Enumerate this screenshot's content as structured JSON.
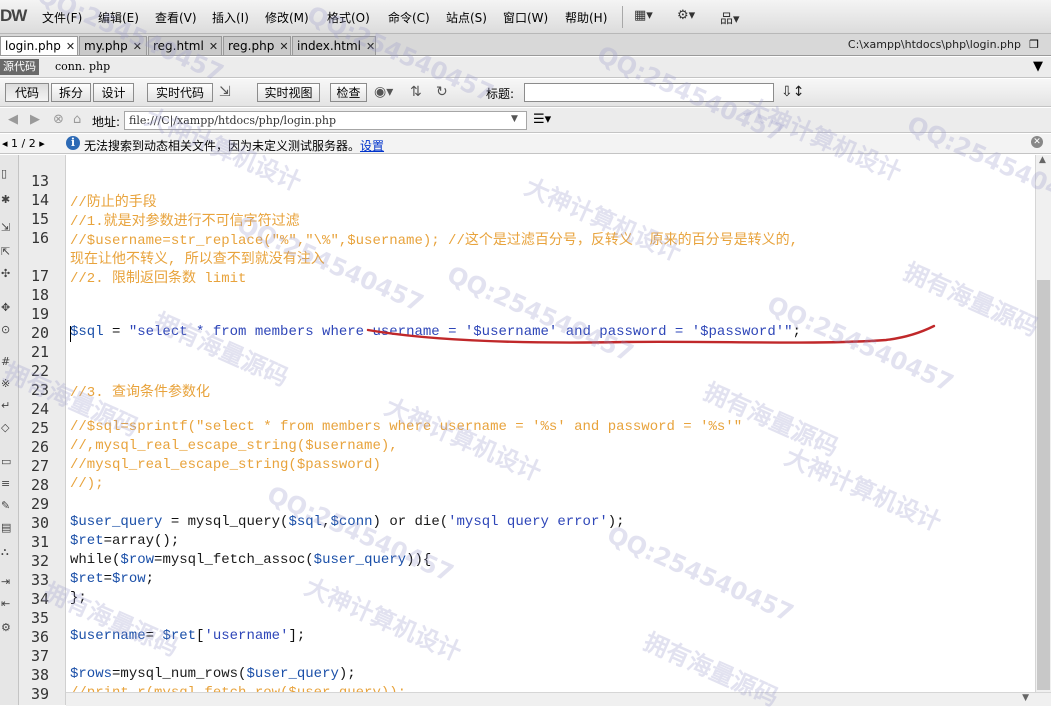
{
  "app": {
    "logo": "DW"
  },
  "menubar": {
    "items": [
      "文件(F)",
      "编辑(E)",
      "查看(V)",
      "插入(I)",
      "修改(M)",
      "格式(O)",
      "命令(C)",
      "站点(S)",
      "窗口(W)",
      "帮助(H)"
    ]
  },
  "tabs": [
    {
      "label": "login.php",
      "active": true
    },
    {
      "label": "my.php",
      "active": false
    },
    {
      "label": "reg.html",
      "active": false
    },
    {
      "label": "reg.php",
      "active": false
    },
    {
      "label": "index.html",
      "active": false
    }
  ],
  "file_path": "C:\\xampp\\htdocs\\php\\login.php",
  "related_files": {
    "source_label": "源代码",
    "file": "conn. php"
  },
  "doc_toolbar": {
    "code": "代码",
    "split": "拆分",
    "design": "设计",
    "live_code": "实时代码",
    "live_view": "实时视图",
    "inspect": "检查",
    "title_label": "标题:",
    "title_value": ""
  },
  "address": {
    "label": "地址:",
    "value": "file:///C|/xampp/htdocs/php/login.php"
  },
  "infobar": {
    "pages": "1 / 2",
    "message": "无法搜索到动态相关文件，因为未定义测试服务器。",
    "link": "设置"
  },
  "code_lines": [
    {
      "n": "13",
      "parts": []
    },
    {
      "n": "14",
      "parts": [
        {
          "c": "cm",
          "t": "//防止的手段"
        }
      ]
    },
    {
      "n": "15",
      "parts": [
        {
          "c": "cm",
          "t": "//1.就是对参数进行不可信字符过滤"
        }
      ]
    },
    {
      "n": "16",
      "parts": [
        {
          "c": "cm",
          "t": "//$username=str_replace(\"%\",\"\\%\",$username); //这个是过滤百分号，反转义  原来的百分号是转义的,"
        }
      ]
    },
    {
      "n": "",
      "parts": [
        {
          "c": "cm",
          "t": "现在让他不转义, 所以查不到就没有注入"
        }
      ]
    },
    {
      "n": "17",
      "parts": [
        {
          "c": "cm",
          "t": "//2. 限制返回条数 limit"
        }
      ]
    },
    {
      "n": "18",
      "parts": []
    },
    {
      "n": "19",
      "parts": []
    },
    {
      "n": "20",
      "parts": [
        {
          "c": "vr",
          "t": "$sql"
        },
        {
          "c": "pl",
          "t": " = "
        },
        {
          "c": "st",
          "t": "\"select * from members where username = '$username' and password = '$password'\""
        },
        {
          "c": "pl",
          "t": ";"
        }
      ]
    },
    {
      "n": "21",
      "parts": []
    },
    {
      "n": "22",
      "parts": []
    },
    {
      "n": "23",
      "parts": [
        {
          "c": "cm",
          "t": "//3. 查询条件参数化"
        }
      ]
    },
    {
      "n": "24",
      "parts": []
    },
    {
      "n": "25",
      "parts": [
        {
          "c": "cm",
          "t": "//$sql=sprintf(\"select * from members where username = '%s' and password = '%s'\""
        }
      ]
    },
    {
      "n": "26",
      "parts": [
        {
          "c": "cm",
          "t": "//,mysql_real_escape_string($username),"
        }
      ]
    },
    {
      "n": "27",
      "parts": [
        {
          "c": "cm",
          "t": "//mysql_real_escape_string($password)"
        }
      ]
    },
    {
      "n": "28",
      "parts": [
        {
          "c": "cm",
          "t": "//);"
        }
      ]
    },
    {
      "n": "29",
      "parts": []
    },
    {
      "n": "30",
      "parts": [
        {
          "c": "vr",
          "t": "$user_query"
        },
        {
          "c": "pl",
          "t": " = "
        },
        {
          "c": "kw",
          "t": "mysql_query("
        },
        {
          "c": "vr",
          "t": "$sql"
        },
        {
          "c": "pl",
          "t": ","
        },
        {
          "c": "vr",
          "t": "$conn"
        },
        {
          "c": "pl",
          "t": ") "
        },
        {
          "c": "kw",
          "t": "or die("
        },
        {
          "c": "st",
          "t": "'mysql query error'"
        },
        {
          "c": "pl",
          "t": ");"
        }
      ]
    },
    {
      "n": "31",
      "parts": [
        {
          "c": "vr",
          "t": "$ret"
        },
        {
          "c": "pl",
          "t": "="
        },
        {
          "c": "kw",
          "t": "array"
        },
        {
          "c": "pl",
          "t": "();"
        }
      ]
    },
    {
      "n": "32",
      "parts": [
        {
          "c": "kw",
          "t": "while"
        },
        {
          "c": "pl",
          "t": "("
        },
        {
          "c": "vr",
          "t": "$row"
        },
        {
          "c": "pl",
          "t": "="
        },
        {
          "c": "kw",
          "t": "mysql_fetch_assoc("
        },
        {
          "c": "vr",
          "t": "$user_query"
        },
        {
          "c": "pl",
          "t": ")){"
        }
      ]
    },
    {
      "n": "33",
      "parts": [
        {
          "c": "vr",
          "t": "$ret"
        },
        {
          "c": "pl",
          "t": "="
        },
        {
          "c": "vr",
          "t": "$row"
        },
        {
          "c": "pl",
          "t": ";"
        }
      ]
    },
    {
      "n": "34",
      "parts": [
        {
          "c": "pl",
          "t": "};"
        }
      ]
    },
    {
      "n": "35",
      "parts": []
    },
    {
      "n": "36",
      "parts": [
        {
          "c": "vr",
          "t": "$username"
        },
        {
          "c": "pl",
          "t": "= "
        },
        {
          "c": "vr",
          "t": "$ret"
        },
        {
          "c": "pl",
          "t": "["
        },
        {
          "c": "st",
          "t": "'username'"
        },
        {
          "c": "pl",
          "t": "];"
        }
      ]
    },
    {
      "n": "37",
      "parts": []
    },
    {
      "n": "38",
      "parts": [
        {
          "c": "vr",
          "t": "$rows"
        },
        {
          "c": "pl",
          "t": "="
        },
        {
          "c": "kw",
          "t": "mysql_num_rows("
        },
        {
          "c": "vr",
          "t": "$user_query"
        },
        {
          "c": "pl",
          "t": ");"
        }
      ]
    },
    {
      "n": "39",
      "parts": [
        {
          "c": "cm",
          "t": "//print_r(mysql_fetch_row($user_query));"
        }
      ]
    }
  ],
  "watermarks": [
    "QQ:254540457",
    "大神计算机设计",
    "拥有海量源码"
  ],
  "colors": {
    "comment": "#e8a33c",
    "variable": "#1a4fa8",
    "string": "#2e46b8",
    "annotation": "#c0282a"
  }
}
